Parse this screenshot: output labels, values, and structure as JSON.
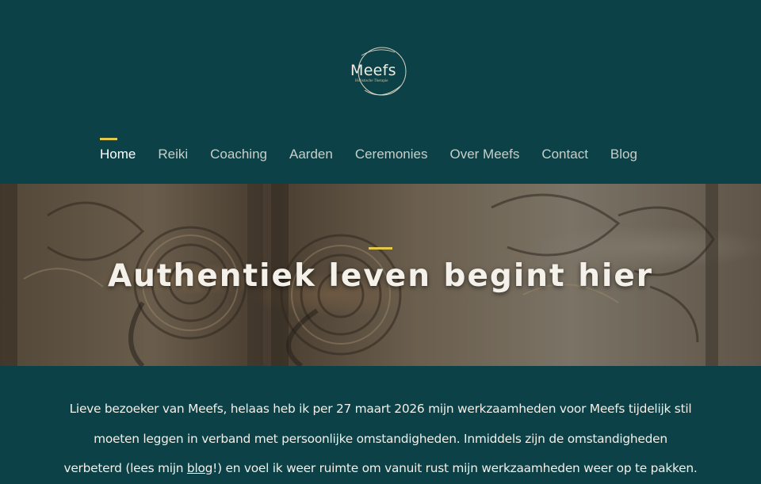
{
  "logo": {
    "name": "Meefs",
    "tagline": "Holistische Therapie"
  },
  "nav": {
    "items": [
      {
        "label": "Home",
        "active": true
      },
      {
        "label": "Reiki"
      },
      {
        "label": "Coaching"
      },
      {
        "label": "Aarden"
      },
      {
        "label": "Ceremonies"
      },
      {
        "label": "Over Meefs"
      },
      {
        "label": "Contact"
      },
      {
        "label": "Blog"
      }
    ]
  },
  "hero": {
    "title": "Authentiek leven begint hier"
  },
  "intro": {
    "line1": "Lieve bezoeker van Meefs,  helaas  heb ik per 27 maart 2026 mijn werkzaamheden voor Meefs tijdelijk stil",
    "line2": "moeten leggen in verband met persoonlijke omstandigheden.  Inmiddels zijn de omstandigheden",
    "line3_before": "verbeterd  (lees mijn ",
    "line3_link": "blog",
    "line3_after": "!) en voel ik weer ruimte om vanuit rust mijn werkzaamheden weer op te pakken."
  },
  "colors": {
    "background": "#0b4147",
    "accent": "#e3c84a",
    "nav_text": "#c8cfc9",
    "nav_active": "#ffffff"
  }
}
